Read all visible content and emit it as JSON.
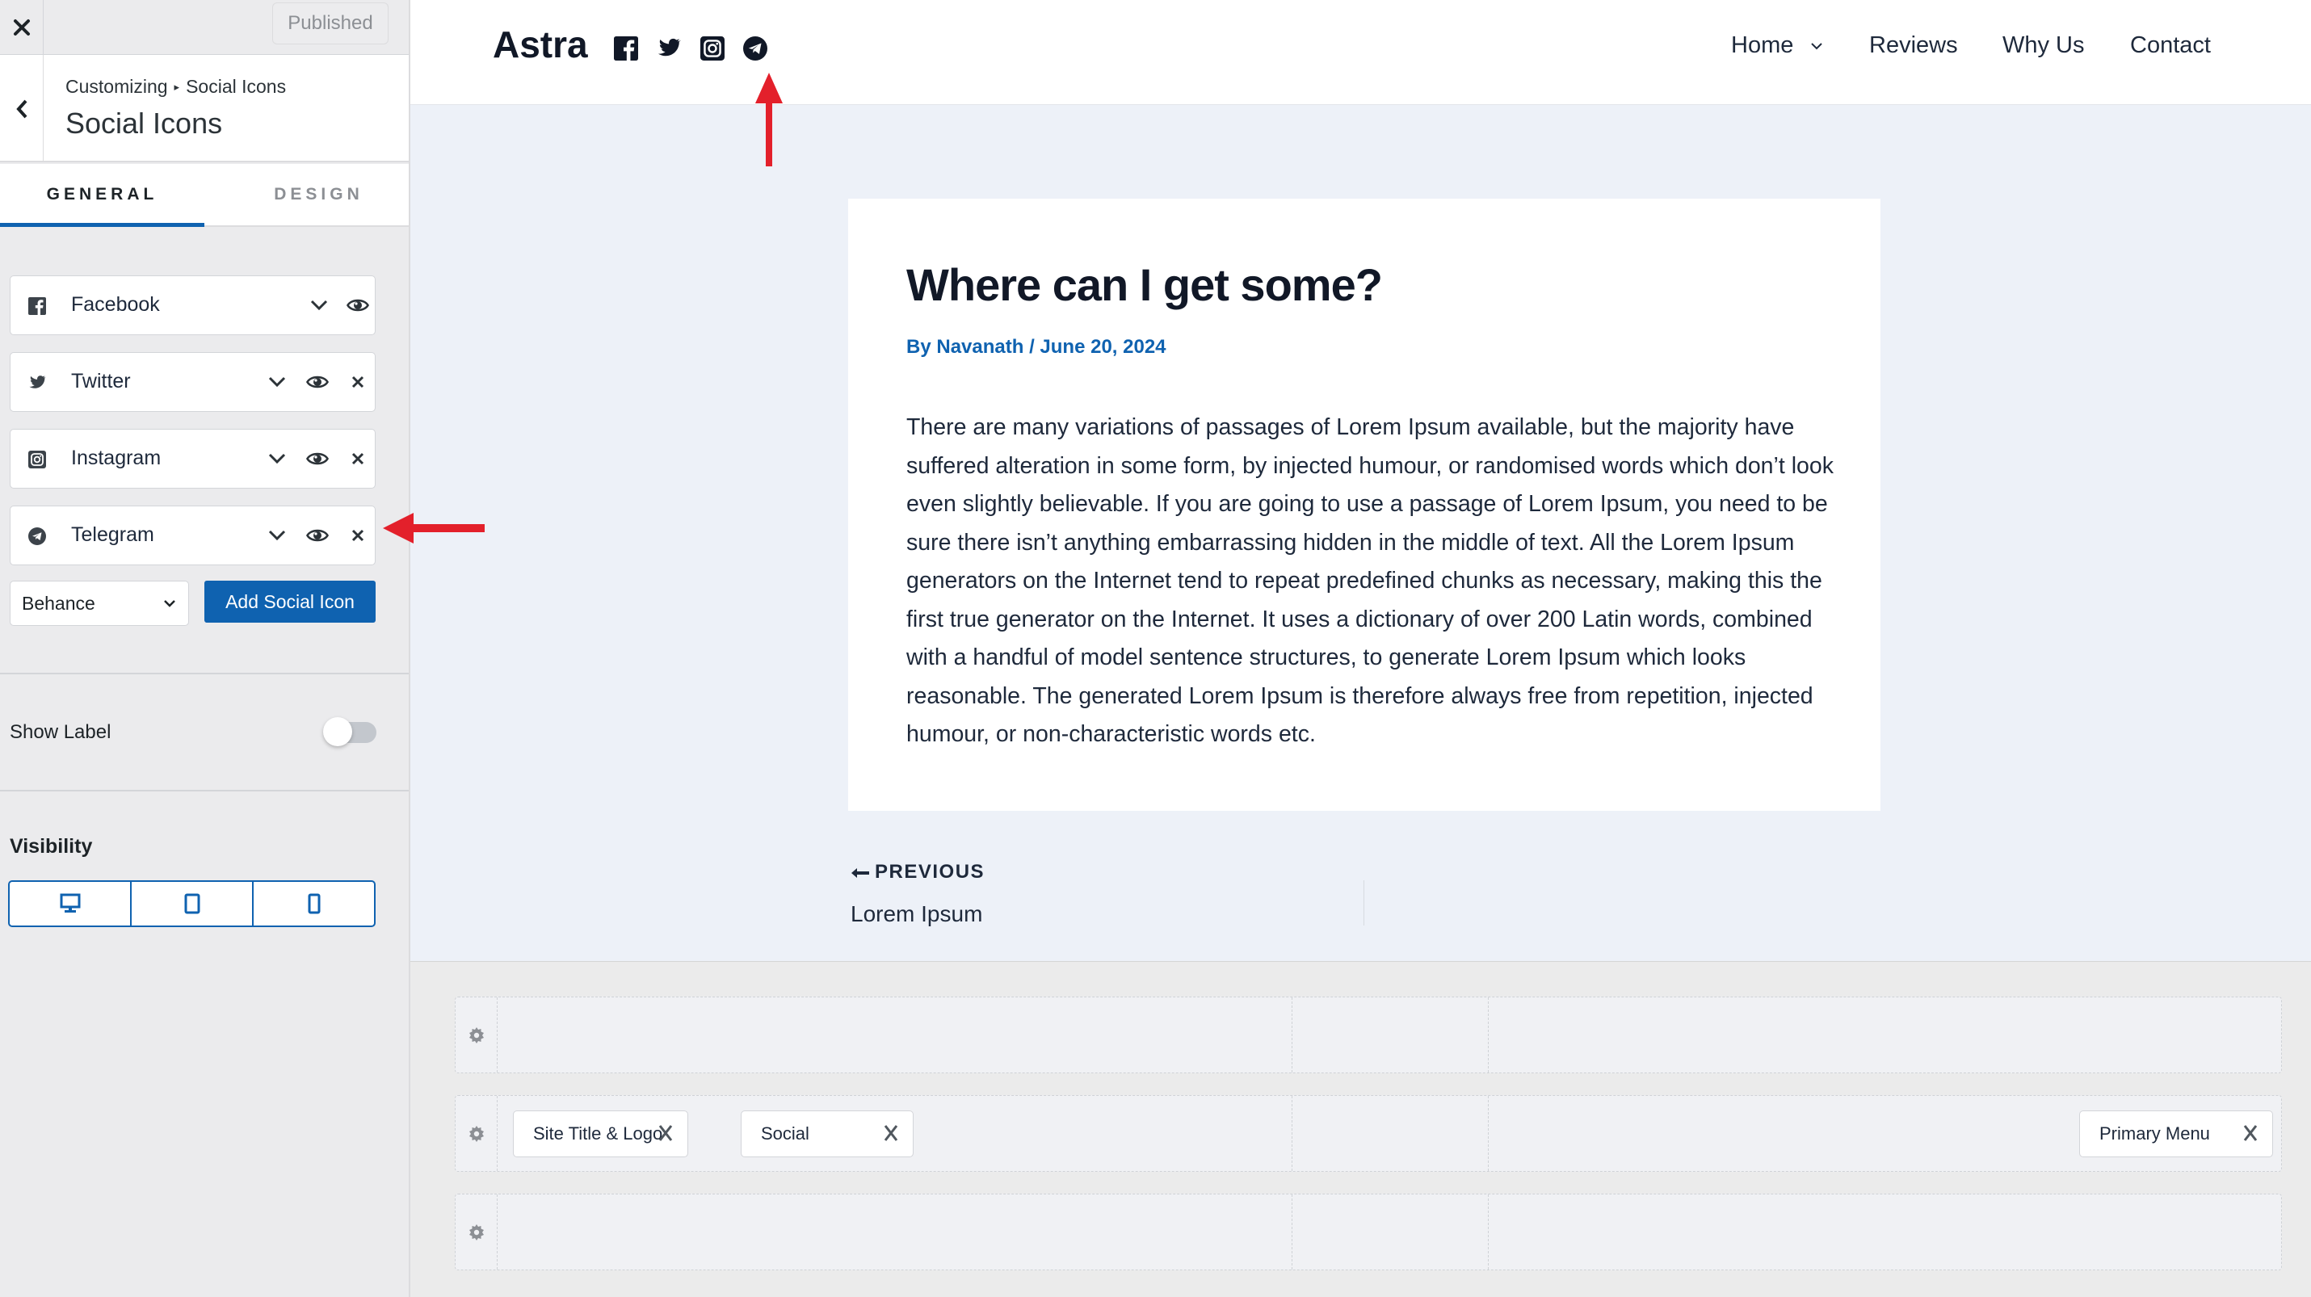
{
  "customizer": {
    "publish_status": "Published",
    "breadcrumb": {
      "root": "Customizing",
      "separator": "▸",
      "current": "Social Icons"
    },
    "section_title": "Social Icons",
    "tabs": [
      {
        "label": "GENERAL",
        "active": true
      },
      {
        "label": "DESIGN",
        "active": false
      }
    ],
    "social_items": [
      {
        "label": "Facebook",
        "icon": "facebook-icon",
        "removable": false
      },
      {
        "label": "Twitter",
        "icon": "twitter-icon",
        "removable": true
      },
      {
        "label": "Instagram",
        "icon": "instagram-icon",
        "removable": true
      },
      {
        "label": "Telegram",
        "icon": "telegram-icon",
        "removable": true
      }
    ],
    "add_select_value": "Behance",
    "add_button_label": "Add Social Icon",
    "show_label": {
      "label": "Show Label",
      "enabled": false
    },
    "visibility": {
      "title": "Visibility",
      "devices": [
        "desktop",
        "tablet",
        "mobile"
      ]
    }
  },
  "site": {
    "title": "Astra",
    "header_social_icons": [
      "facebook-icon",
      "twitter-icon",
      "instagram-icon",
      "telegram-icon"
    ],
    "nav": [
      {
        "label": "Home",
        "has_dropdown": true
      },
      {
        "label": "Reviews",
        "has_dropdown": false
      },
      {
        "label": "Why Us",
        "has_dropdown": false
      },
      {
        "label": "Contact",
        "has_dropdown": false
      }
    ],
    "article": {
      "title": "Where can I get some?",
      "meta_prefix": "By",
      "author": "Navanath",
      "meta_sep": "/",
      "date": "June 20, 2024",
      "body": "There are many variations of passages of Lorem Ipsum available, but the majority have suffered alteration in some form, by injected humour, or randomised words which don’t look even slightly believable. If you are going to use a passage of Lorem Ipsum, you need to be sure there isn’t anything embarrassing hidden in the middle of text. All the Lorem Ipsum generators on the Internet tend to repeat predefined chunks as necessary, making this the first true generator on the Internet. It uses a dictionary of over 200 Latin words, combined with a handful of model sentence structures, to generate Lorem Ipsum which looks reasonable. The generated Lorem Ipsum is therefore always free from repetition, injected humour, or non-characteristic words etc."
    },
    "post_nav": {
      "previous_label": "PREVIOUS",
      "previous_title": "Lorem Ipsum"
    }
  },
  "header_builder": {
    "rows": [
      {
        "name": "above-header",
        "chips": []
      },
      {
        "name": "primary-header",
        "chips": [
          "Site Title & Logo",
          "Social",
          "Primary Menu"
        ]
      },
      {
        "name": "below-header",
        "chips": []
      }
    ]
  },
  "colors": {
    "accent": "#0f62b0",
    "annotation": "#e3202b",
    "preview_bg": "#edf1f8"
  }
}
